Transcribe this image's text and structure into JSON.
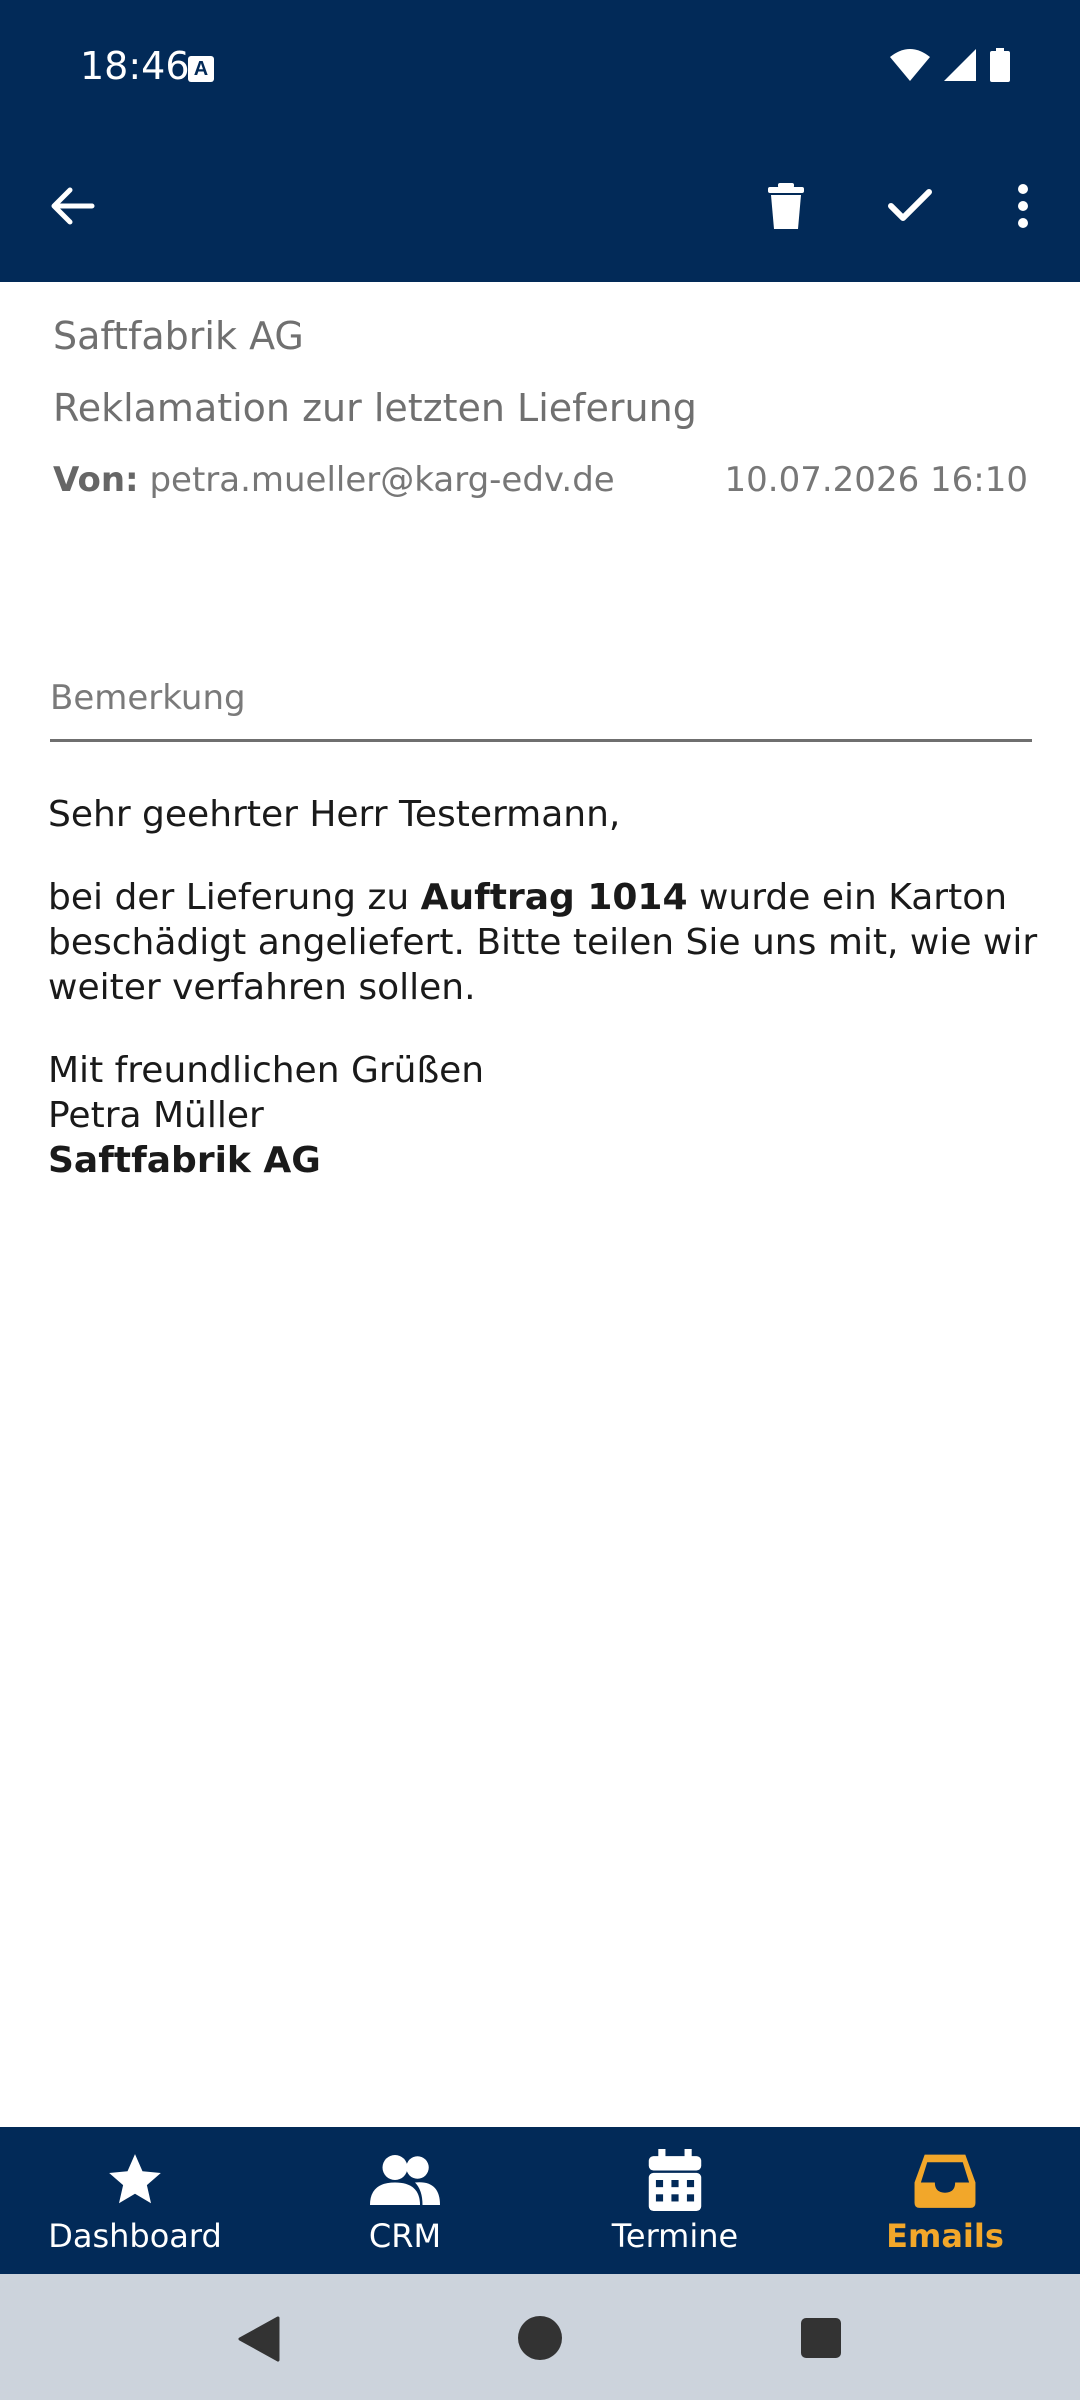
{
  "status": {
    "time": "18:46",
    "notification_badge": "A"
  },
  "toolbar": {
    "back": "back-arrow-icon",
    "delete": "trash-icon",
    "confirm": "check-icon",
    "more": "more-vertical-icon"
  },
  "email": {
    "company": "Saftfabrik AG",
    "subject": "Reklamation zur letzten Lieferung",
    "from_label": "Von:",
    "from_address": "petra.mueller@karg-edv.de",
    "date": "10.07.2026 16:10",
    "remark_label": "Bemerkung",
    "greeting": "Sehr geehrter Herr Testermann,",
    "para1_pre": "bei der Lieferung zu ",
    "para1_bold": "Auftrag 1014",
    "para1_post": " wurde ein Karton beschädigt angeliefert. Bitte teilen Sie uns mit, wie wir weiter verfahren sollen.",
    "closing": "Mit freundlichen Grüßen",
    "sender_name": "Petra Müller",
    "sender_company": "Saftfabrik AG"
  },
  "nav": {
    "items": [
      {
        "label": "Dashboard",
        "icon": "star-icon"
      },
      {
        "label": "CRM",
        "icon": "people-icon"
      },
      {
        "label": "Termine",
        "icon": "calendar-icon"
      },
      {
        "label": "Emails",
        "icon": "inbox-icon"
      }
    ],
    "active": "Emails"
  },
  "colors": {
    "primary": "#022a58",
    "accent": "#f2a72a",
    "sysnav": "#ccd3dc"
  }
}
